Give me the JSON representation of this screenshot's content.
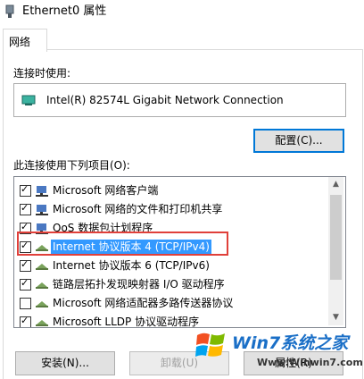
{
  "window": {
    "title": "Ethernet0 属性",
    "tab": "网络"
  },
  "connect_using_label": "连接时使用:",
  "adapter": {
    "name": "Intel(R) 82574L Gigabit Network Connection",
    "icon": "network-adapter-icon"
  },
  "configure_button": "配置(C)...",
  "items_label": "此连接使用下列项目(O):",
  "items": [
    {
      "label": "Microsoft 网络客户端",
      "checked": true,
      "icon": "network-client-icon"
    },
    {
      "label": "Microsoft 网络的文件和打印机共享",
      "checked": true,
      "icon": "file-share-icon"
    },
    {
      "label": "QoS 数据包计划程序",
      "checked": true,
      "icon": "qos-icon"
    },
    {
      "label": "Internet 协议版本 4 (TCP/IPv4)",
      "checked": true,
      "icon": "protocol-icon",
      "selected": true
    },
    {
      "label": "Internet 协议版本 6 (TCP/IPv6)",
      "checked": true,
      "icon": "protocol-icon"
    },
    {
      "label": "链路层拓扑发现映射器 I/O 驱动程序",
      "checked": true,
      "icon": "protocol-icon"
    },
    {
      "label": "Microsoft 网络适配器多路传送器协议",
      "checked": false,
      "icon": "protocol-icon"
    },
    {
      "label": "Microsoft LLDP 协议驱动程序",
      "checked": true,
      "icon": "protocol-icon"
    }
  ],
  "buttons": {
    "install": "安装(N)...",
    "uninstall": "卸载(U)",
    "properties": "属性(R)"
  },
  "watermark": {
    "text": "Win7系统之家",
    "url": "Www.Winwin7.com"
  },
  "colors": {
    "selection": "#3399ff",
    "highlight_box": "#e0403a",
    "focus_border": "#0078d7"
  }
}
